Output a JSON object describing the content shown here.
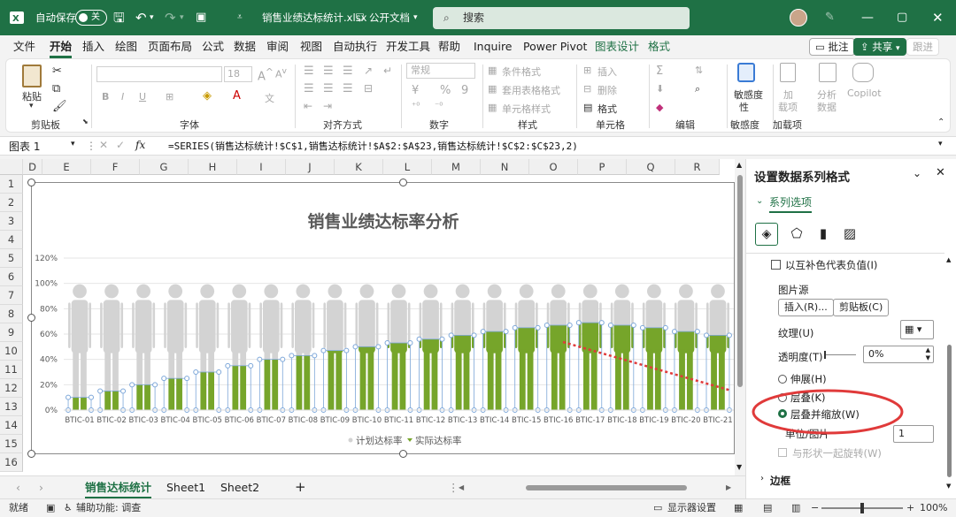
{
  "titlebar": {
    "autosave_label": "自动保存",
    "autosave_state": "关",
    "filename": "销售业绩达标统计.xlsx",
    "visibility": "公开文档",
    "search_placeholder": "搜索"
  },
  "menu": {
    "items": [
      "文件",
      "开始",
      "插入",
      "绘图",
      "页面布局",
      "公式",
      "数据",
      "审阅",
      "视图",
      "自动执行",
      "开发工具",
      "帮助",
      "Inquire",
      "Power Pivot",
      "图表设计",
      "格式"
    ],
    "comment_button": "批注",
    "share_button": "共享",
    "catchup_button": "跟进"
  },
  "ribbon": {
    "groups": [
      "剪贴板",
      "字体",
      "对齐方式",
      "数字",
      "样式",
      "单元格",
      "编辑",
      "敏感度",
      "加载项"
    ],
    "paste": "粘贴",
    "font_size": "18",
    "number_format": "常规",
    "conditional_format": "条件格式",
    "table_format": "套用表格格式",
    "cell_style": "单元格样式",
    "insert": "插入",
    "delete": "删除",
    "format": "格式",
    "sensitivity": "敏感度",
    "sensitivity2": "性",
    "addins": "加载项",
    "addins_short1": "加",
    "addins_short2": "载项",
    "analyze1": "分析",
    "analyze2": "数据",
    "copilot": "Copilot"
  },
  "formula_bar": {
    "name_box": "图表 1",
    "fx": "fx",
    "formula": "=SERIES(销售达标统计!$C$1,销售达标统计!$A$2:$A$23,销售达标统计!$C$2:$C$23,2)"
  },
  "grid": {
    "columns": [
      "D",
      "E",
      "F",
      "G",
      "H",
      "I",
      "J",
      "K",
      "L",
      "M",
      "N",
      "O",
      "P",
      "Q",
      "R"
    ],
    "rows": [
      "1",
      "2",
      "3",
      "4",
      "5",
      "6",
      "7",
      "8",
      "9",
      "10",
      "11",
      "12",
      "13",
      "14",
      "15",
      "16"
    ]
  },
  "chart_data": {
    "type": "bar",
    "title": "销售业绩达标率分析",
    "categories": [
      "BTIC-01",
      "BTIC-02",
      "BTIC-03",
      "BTIC-04",
      "BTIC-05",
      "BTIC-06",
      "BTIC-07",
      "BTIC-08",
      "BTIC-09",
      "BTIC-10",
      "BTIC-11",
      "BTIC-12",
      "BTIC-13",
      "BTIC-14",
      "BTIC-15",
      "BTIC-16",
      "BTIC-17",
      "BTIC-18",
      "BTIC-19",
      "BTIC-20",
      "BTIC-21"
    ],
    "y_ticks": [
      "120%",
      "100%",
      "80%",
      "60%",
      "40%",
      "20%",
      "0%"
    ],
    "ylim": [
      0,
      1.2
    ],
    "series": [
      {
        "name": "计划达标率",
        "values": [
          1,
          1,
          1,
          1,
          1,
          1,
          1,
          1,
          1,
          1,
          1,
          1,
          1,
          1,
          1,
          1,
          1,
          1,
          1,
          1,
          1
        ]
      },
      {
        "name": "实际达标率",
        "values": [
          0.1,
          0.15,
          0.2,
          0.25,
          0.3,
          0.35,
          0.4,
          0.43,
          0.47,
          0.5,
          0.53,
          0.56,
          0.59,
          0.62,
          0.65,
          0.67,
          0.69,
          0.67,
          0.65,
          0.62,
          0.59
        ]
      }
    ],
    "colors": {
      "plan": "#d3d3d3",
      "actual": "#76a52a"
    },
    "legend_position": "bottom"
  },
  "sheets": {
    "tabs": [
      "销售达标统计",
      "Sheet1",
      "Sheet2"
    ],
    "add": "+"
  },
  "status": {
    "ready": "就绪",
    "accessibility": "辅助功能: 调查",
    "display_settings": "显示器设置",
    "zoom": "100%"
  },
  "pane": {
    "title": "设置数据系列格式",
    "tab": "系列选项",
    "invert_if_negative": "以互补色代表负值(I)",
    "picture_source": "图片源",
    "insert_btn": "插入(R)...",
    "clipboard_btn": "剪贴板(C)",
    "texture": "纹理(U)",
    "transparency": "透明度(T)",
    "transparency_value": "0%",
    "stretch": "伸展(H)",
    "stack": "层叠(K)",
    "stack_scale": "层叠并缩放(W)",
    "units_per_picture": "单位/图片",
    "units_value": "1",
    "rotate_with_shape": "与形状一起旋转(W)",
    "border": "边框"
  },
  "accent": "#1f7145"
}
